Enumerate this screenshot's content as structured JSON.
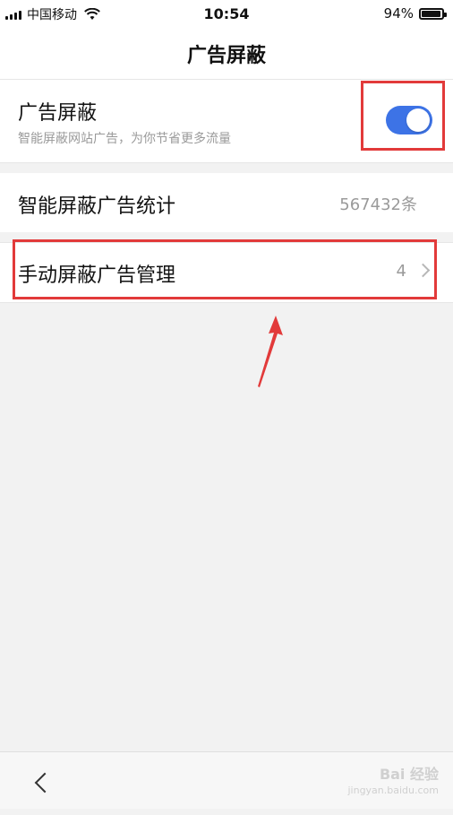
{
  "status_bar": {
    "carrier": "中国移动",
    "time": "10:54",
    "battery": "94%",
    "battery_level": 0.94
  },
  "nav": {
    "title": "广告屏蔽"
  },
  "ad_block": {
    "title": "广告屏蔽",
    "subtitle": "智能屏蔽网站广告，为你节省更多流量",
    "enabled": true,
    "toggle_color": "#3d73e6"
  },
  "smart_stats": {
    "title": "智能屏蔽广告统计",
    "value": "567432条"
  },
  "manual": {
    "title": "手动屏蔽广告管理",
    "count": "4"
  },
  "annotation_color": "#e23a3a",
  "watermark": {
    "text": "Bai 经验",
    "sub": "jingyan.baidu.com"
  }
}
